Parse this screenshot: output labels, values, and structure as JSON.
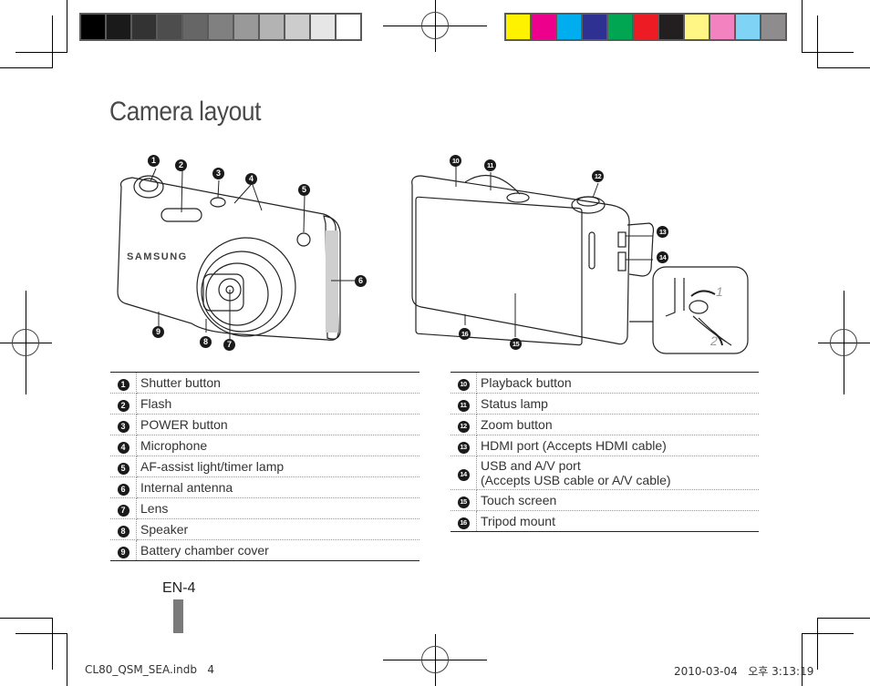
{
  "print_marks": {
    "grayscale_swatches": [
      "#000000",
      "#1a1a1a",
      "#333333",
      "#4d4d4d",
      "#666666",
      "#808080",
      "#999999",
      "#b3b3b3",
      "#cccccc",
      "#e6e6e6",
      "#ffffff"
    ],
    "color_swatches": [
      "#fff200",
      "#ec008c",
      "#00aeef",
      "#2e3192",
      "#00a651",
      "#ed1c24",
      "#231f20",
      "#fff685",
      "#f282c0",
      "#7fd4f6",
      "#8e8c8c"
    ]
  },
  "page": {
    "title": "Camera layout",
    "page_number": "EN-4"
  },
  "figures": {
    "front": {
      "brand": "SAMSUNG",
      "callouts": [
        "1",
        "2",
        "3",
        "4",
        "5",
        "6",
        "7",
        "8",
        "9"
      ]
    },
    "back": {
      "callouts": [
        "10",
        "11",
        "12",
        "13",
        "14",
        "15",
        "16"
      ],
      "strap_steps": [
        "1",
        "2"
      ]
    }
  },
  "parts_left": [
    {
      "num": "1",
      "label": "Shutter button"
    },
    {
      "num": "2",
      "label": "Flash"
    },
    {
      "num": "3",
      "label": "POWER button"
    },
    {
      "num": "4",
      "label": "Microphone"
    },
    {
      "num": "5",
      "label": "AF-assist light/timer lamp"
    },
    {
      "num": "6",
      "label": "Internal antenna"
    },
    {
      "num": "7",
      "label": "Lens"
    },
    {
      "num": "8",
      "label": "Speaker"
    },
    {
      "num": "9",
      "label": "Battery chamber cover"
    }
  ],
  "parts_right": [
    {
      "num": "10",
      "label": "Playback button"
    },
    {
      "num": "11",
      "label": "Status lamp"
    },
    {
      "num": "12",
      "label": "Zoom button"
    },
    {
      "num": "13",
      "label": "HDMI port (Accepts HDMI cable)"
    },
    {
      "num": "14",
      "label": "USB and A/V port",
      "label2": "(Accepts USB cable or A/V cable)"
    },
    {
      "num": "15",
      "label": "Touch screen"
    },
    {
      "num": "16",
      "label": "Tripod mount"
    }
  ],
  "footer": {
    "file": "CL80_QSM_SEA.indb",
    "file_page": "4",
    "date": "2010-03-04",
    "time": "오후 3:13:19"
  }
}
